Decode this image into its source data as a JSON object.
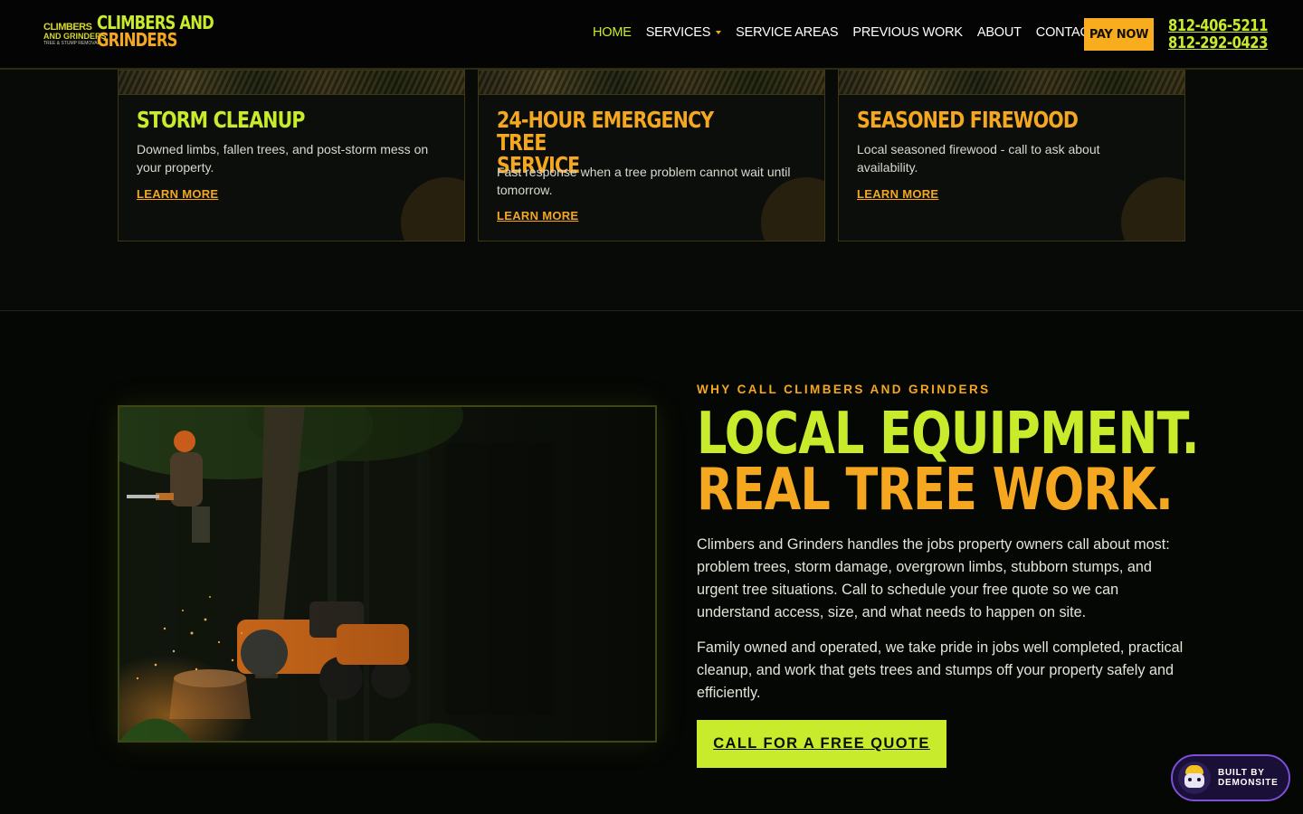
{
  "brand": {
    "logo_line1": "CLIMBERS",
    "logo_line2": "AND GRINDERS",
    "logo_line3": "TREE & STUMP REMOVAL",
    "name_line1": "CLIMBERS AND",
    "name_line2": "GRINDERS"
  },
  "nav": {
    "items": [
      "HOME",
      "SERVICES",
      "SERVICE AREAS",
      "PREVIOUS WORK",
      "ABOUT",
      "CONTACT"
    ],
    "active": "HOME",
    "pay_now": "PAY NOW",
    "phones": [
      "812-406-5211",
      "812-292-0423"
    ]
  },
  "cards": [
    {
      "title": "STORM CLEANUP",
      "desc": "Downed limbs, fallen trees, and post-storm mess on your property.",
      "link": "LEARN MORE"
    },
    {
      "title": "24-HOUR EMERGENCY TREE SERVICE",
      "title_line1": "24-HOUR EMERGENCY TREE",
      "title_line2": "SERVICE",
      "desc": "Fast response when a tree problem cannot wait until tomorrow.",
      "link": "LEARN MORE"
    },
    {
      "title": "SEASONED FIREWOOD",
      "desc": "Local seasoned firewood - call to ask about availability.",
      "link": "LEARN MORE"
    }
  ],
  "why": {
    "eyebrow": "WHY CALL CLIMBERS AND GRINDERS",
    "headline_line1": "LOCAL EQUIPMENT.",
    "headline_line2": "REAL TREE WORK.",
    "para1": "Climbers and Grinders handles the jobs property owners call about most: problem trees, storm damage, overgrown limbs, stubborn stumps, and urgent tree situations. Call to schedule your free quote so we can understand access, size, and what needs to happen on site.",
    "para2": "Family owned and operated, we take pride in jobs well completed, practical cleanup, and work that gets trees and stumps off your property safely and efficiently.",
    "cta": "CALL FOR A FREE QUOTE"
  },
  "badge": {
    "line1": "BUILT BY",
    "line2": "DEMONSITE"
  },
  "colors": {
    "lime": "#c8ec2b",
    "orange": "#f4a71f",
    "background": "#070a06"
  }
}
